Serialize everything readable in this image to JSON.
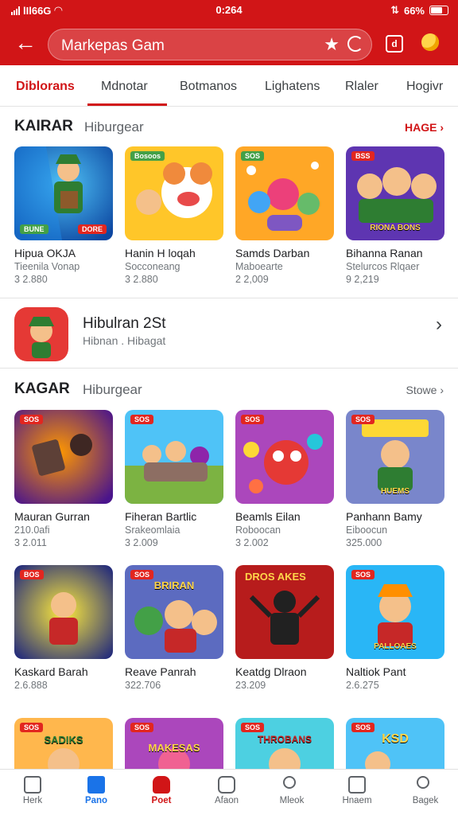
{
  "status_bar": {
    "carrier": "lIl66G",
    "time": "0:264",
    "battery": "66%"
  },
  "toolbar": {
    "search_text": "Markepas Gam",
    "icon_box_label": "d"
  },
  "tabs": [
    "Diblorans",
    "Mdnotar",
    "Botmanos",
    "Lighatens",
    "Rlaler",
    "Hogivr"
  ],
  "section1": {
    "title": "KAIRAR",
    "subtitle": "Hiburgear",
    "more": "HAGE",
    "cards": [
      {
        "name": "Hipua OKJA",
        "sub": "Tieenila Vonap",
        "count": "3 2.880",
        "badge": "BUNE",
        "label": "DORE"
      },
      {
        "name": "Hanin H loqah",
        "sub": "Socconeang",
        "count": "3 2.880",
        "badge": "Bosoos",
        "label": ""
      },
      {
        "name": "Samds Darban",
        "sub": "Maboearte",
        "count": "2 2,009",
        "badge": "SOS",
        "label": ""
      },
      {
        "name": "Bihanna Ranan",
        "sub": "Stelurcos Rlqaer",
        "count": "9 2,219",
        "badge": "BSS",
        "label": "RIONA BONS"
      }
    ]
  },
  "featured": {
    "title": "Hibulran 2St",
    "subtitle": "Hibnan . Hibagat"
  },
  "section2": {
    "title": "KAGAR",
    "subtitle": "Hiburgear",
    "more": "Stowe",
    "rows": [
      [
        {
          "name": "Mauran Gurran",
          "sub": "210.0afi",
          "count": "3 2.011",
          "badge": "SOS",
          "label": ""
        },
        {
          "name": "Fiheran Bartlic",
          "sub": "Srakeomlaia",
          "count": "3 2.009",
          "badge": "SOS",
          "label": ""
        },
        {
          "name": "Beamls Eilan",
          "sub": "Roboocan",
          "count": "3 2.002",
          "badge": "SOS",
          "label": ""
        },
        {
          "name": "Panhann Bamy",
          "sub": "Eiboocun",
          "count": "325.000",
          "badge": "SOS",
          "label": "HUEMS"
        }
      ],
      [
        {
          "name": "Kaskard Barah",
          "sub": "",
          "count": "2.6.888",
          "badge": "BOS",
          "label": ""
        },
        {
          "name": "Reave Panrah",
          "sub": "",
          "count": "322.706",
          "badge": "SOS",
          "label": "BRIRAN"
        },
        {
          "name": "Keatdg Dlraon",
          "sub": "",
          "count": "23.209",
          "badge": "DROS AKES",
          "label": ""
        },
        {
          "name": "Naltiok Pant",
          "sub": "",
          "count": "2.6.275",
          "badge": "SOS",
          "label": "PALLOAES"
        }
      ],
      [
        {
          "name": "",
          "sub": "",
          "count": "",
          "badge": "SOS",
          "label": "SADIKS"
        },
        {
          "name": "",
          "sub": "",
          "count": "",
          "badge": "SOS",
          "label": "MAKESAS"
        },
        {
          "name": "",
          "sub": "",
          "count": "",
          "badge": "SOS",
          "label": "THROBANS"
        },
        {
          "name": "",
          "sub": "",
          "count": "",
          "badge": "SOS",
          "label": "KSD"
        }
      ]
    ]
  },
  "bottom_nav": [
    "Herk",
    "Pano",
    "Poet",
    "Afaon",
    "Mleok",
    "Hnaem",
    "Bagek"
  ],
  "colors": {
    "brand_red": "#d11517",
    "active_blue": "#1a73e8"
  }
}
